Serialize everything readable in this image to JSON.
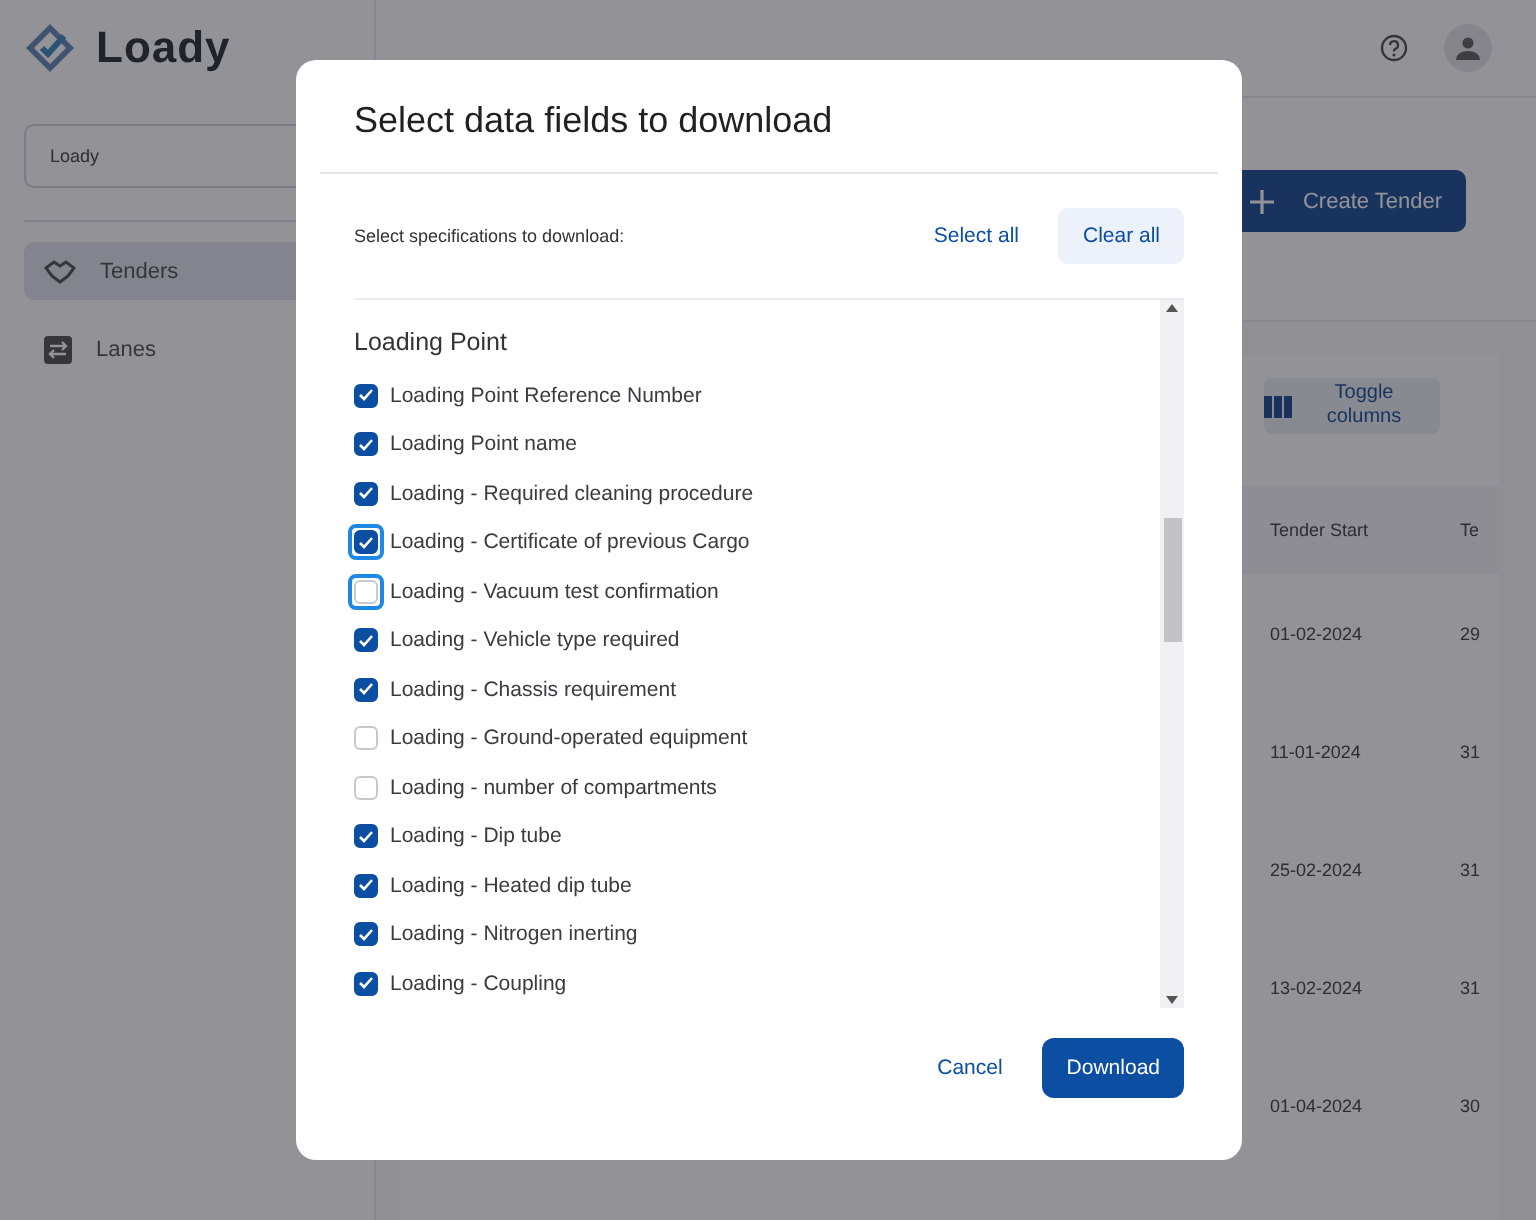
{
  "app": {
    "logo": "Loady"
  },
  "sidebar": {
    "workspace_field": {
      "value": "Loady"
    },
    "items": [
      {
        "label": "Tenders",
        "selected": true,
        "kind": "tenders"
      },
      {
        "label": "Lanes",
        "selected": false,
        "kind": "lanes"
      }
    ]
  },
  "toolbar": {
    "create_button": "Create Tender",
    "toggle_button": "Toggle columns"
  },
  "table": {
    "columns": [
      "Tender Start",
      "Te"
    ],
    "rows": [
      [
        "01-02-2024",
        "29"
      ],
      [
        "11-01-2024",
        "31"
      ],
      [
        "25-02-2024",
        "31"
      ],
      [
        "13-02-2024",
        "31"
      ],
      [
        "01-04-2024",
        "30"
      ]
    ]
  },
  "dialog": {
    "title": "Select data fields to download",
    "subtitle": "Select specifications to download:",
    "select_all": "Select all",
    "clear_all": "Clear all",
    "section": "Loading Point",
    "fields": [
      {
        "label": "Loading Point Reference Number",
        "checked": true,
        "focused": false
      },
      {
        "label": "Loading Point name",
        "checked": true,
        "focused": false
      },
      {
        "label": "Loading - Required cleaning procedure",
        "checked": true,
        "focused": false
      },
      {
        "label": "Loading - Certificate of previous Cargo",
        "checked": true,
        "focused": true
      },
      {
        "label": "Loading - Vacuum test confirmation",
        "checked": false,
        "focused": true
      },
      {
        "label": "Loading - Vehicle type required",
        "checked": true,
        "focused": false
      },
      {
        "label": "Loading - Chassis requirement",
        "checked": true,
        "focused": false
      },
      {
        "label": "Loading - Ground-operated equipment",
        "checked": false,
        "focused": false
      },
      {
        "label": "Loading - number of compartments",
        "checked": false,
        "focused": false
      },
      {
        "label": "Loading - Dip tube",
        "checked": true,
        "focused": false
      },
      {
        "label": "Loading - Heated dip tube",
        "checked": true,
        "focused": false
      },
      {
        "label": "Loading - Nitrogen inerting",
        "checked": true,
        "focused": false
      },
      {
        "label": "Loading - Coupling",
        "checked": true,
        "focused": false
      }
    ],
    "cancel": "Cancel",
    "download": "Download"
  }
}
